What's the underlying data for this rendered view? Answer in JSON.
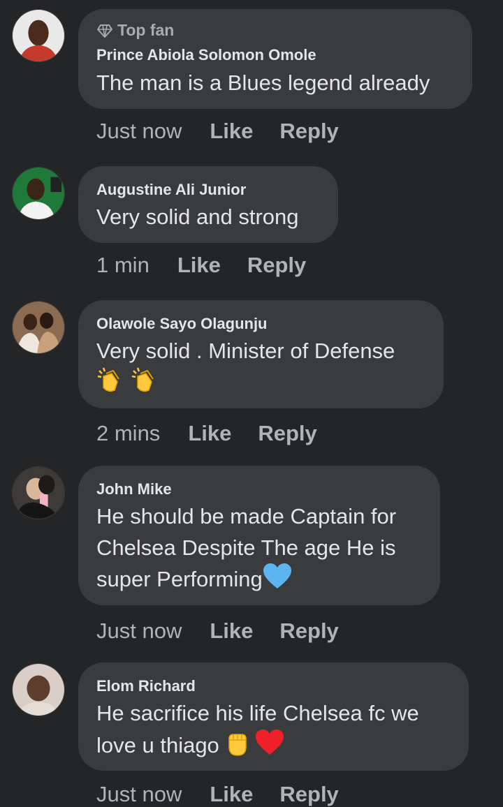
{
  "comments": [
    {
      "badge": "Top fan",
      "author": "Prince Abiola Solomon Omole",
      "text": "The man is a Blues legend already",
      "time": "Just now",
      "like": "Like",
      "reply": "Reply"
    },
    {
      "author": "Augustine Ali Junior",
      "text": "Very solid and strong",
      "time": "1 min",
      "like": "Like",
      "reply": "Reply"
    },
    {
      "author": "Olawole Sayo Olagunju",
      "text": "Very solid . Minister of Defense",
      "emojis": [
        "clapping-hands",
        "clapping-hands"
      ],
      "time": "2 mins",
      "like": "Like",
      "reply": "Reply"
    },
    {
      "author": "John Mike",
      "text_lines": [
        "He should be made Captain for",
        "Chelsea Despite The age He is",
        "super Performing"
      ],
      "emojis": [
        "blue-heart"
      ],
      "time": "Just now",
      "like": "Like",
      "reply": "Reply"
    },
    {
      "author": "Elom Richard",
      "text_lines": [
        "He sacrifice his life Chelsea fc we",
        "love u thiago"
      ],
      "emojis": [
        "raised-fist",
        "red-heart"
      ],
      "time": "Just now",
      "like": "Like",
      "reply": "Reply"
    }
  ],
  "colors": {
    "background": "#242526",
    "bubble": "#3a3b3c",
    "text": "#e4e6eb",
    "muted": "#b0b3b8"
  }
}
